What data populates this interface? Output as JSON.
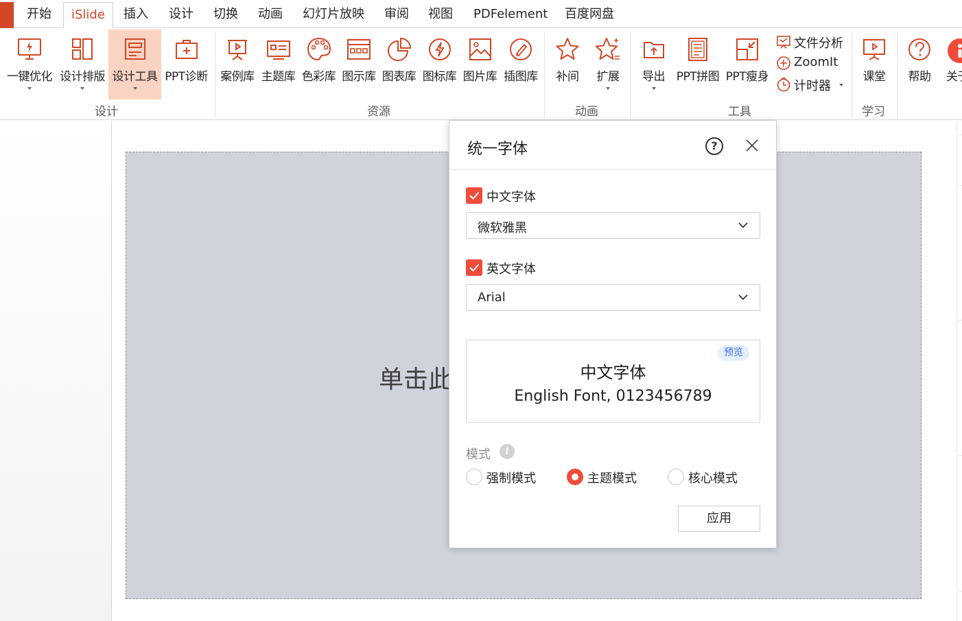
{
  "tabs": [
    {
      "label": "开始",
      "active": false
    },
    {
      "label": "iSlide",
      "active": true
    },
    {
      "label": "插入",
      "active": false
    },
    {
      "label": "设计",
      "active": false
    },
    {
      "label": "切换",
      "active": false
    },
    {
      "label": "动画",
      "active": false
    },
    {
      "label": "幻灯片放映",
      "active": false
    },
    {
      "label": "审阅",
      "active": false
    },
    {
      "label": "视图",
      "active": false
    },
    {
      "label": "PDFelement",
      "active": false
    },
    {
      "label": "百度网盘",
      "active": false
    }
  ],
  "ribbon": {
    "buttons": [
      {
        "label": "一键优化",
        "icon": "monitor-lightning-icon",
        "dropdown": true
      },
      {
        "label": "设计排版",
        "icon": "layout-columns-icon",
        "dropdown": true
      },
      {
        "label": "设计工具",
        "icon": "design-tools-icon",
        "dropdown": true,
        "active": true
      },
      {
        "label": "PPT诊断",
        "icon": "first-aid-kit-icon",
        "dropdown": false
      },
      {
        "label": "案例库",
        "icon": "presentation-board-icon",
        "dropdown": false
      },
      {
        "label": "主题库",
        "icon": "theme-card-icon",
        "dropdown": false
      },
      {
        "label": "色彩库",
        "icon": "color-palette-icon",
        "dropdown": false
      },
      {
        "label": "图示库",
        "icon": "diagram-grid-icon",
        "dropdown": false
      },
      {
        "label": "图表库",
        "icon": "pie-chart-icon",
        "dropdown": false
      },
      {
        "label": "图标库",
        "icon": "lightning-circle-icon",
        "dropdown": false
      },
      {
        "label": "图片库",
        "icon": "picture-icon",
        "dropdown": false
      },
      {
        "label": "插图库",
        "icon": "pen-brush-icon",
        "dropdown": false
      },
      {
        "label": "补间",
        "icon": "star-icon",
        "dropdown": false
      },
      {
        "label": "扩展",
        "icon": "star-sparkle-icon",
        "dropdown": true
      },
      {
        "label": "导出",
        "icon": "export-icon",
        "dropdown": true
      },
      {
        "label": "PPT拼图",
        "icon": "document-lines-icon",
        "dropdown": false
      },
      {
        "label": "PPT瘦身",
        "icon": "compress-icon",
        "dropdown": false
      },
      {
        "label": "课堂",
        "icon": "classroom-board-icon",
        "dropdown": false
      },
      {
        "label": "帮助",
        "icon": "help-circle-icon",
        "dropdown": false
      },
      {
        "label": "关于",
        "icon": "islide-logo-icon",
        "dropdown": false
      }
    ],
    "small_buttons": [
      {
        "label": "文件分析",
        "icon": "file-analysis-icon",
        "dropdown": false
      },
      {
        "label": "ZoomIt",
        "icon": "zoom-plus-icon",
        "dropdown": false
      },
      {
        "label": "计时器",
        "icon": "timer-icon",
        "dropdown": true
      }
    ],
    "groups": [
      {
        "label": "设计"
      },
      {
        "label": "资源"
      },
      {
        "label": "动画"
      },
      {
        "label": "工具"
      },
      {
        "label": "学习"
      }
    ]
  },
  "slide": {
    "placeholder_text": "单击此"
  },
  "dialog": {
    "title": "统一字体",
    "help_glyph": "?",
    "chinese_font": {
      "label": "中文字体",
      "checked": true,
      "value": "微软雅黑"
    },
    "english_font": {
      "label": "英文字体",
      "checked": true,
      "value": "Arial"
    },
    "preview": {
      "badge": "预览",
      "chinese_sample": "中文字体",
      "english_sample": "English Font, 0123456789"
    },
    "mode": {
      "label": "模式",
      "info_glyph": "i",
      "options": [
        {
          "label": "强制模式",
          "selected": false
        },
        {
          "label": "主题模式",
          "selected": true
        },
        {
          "label": "核心模式",
          "selected": false
        }
      ]
    },
    "apply_label": "应用"
  },
  "colors": {
    "accent": "#ef4c3a",
    "brand": "#d24726",
    "active_button_bg": "#fbd3c3",
    "slide_bg": "#d0d3dc",
    "preview_badge": "#3d73d9"
  }
}
